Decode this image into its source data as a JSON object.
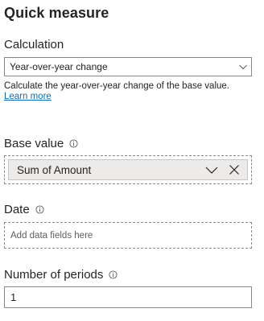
{
  "panel": {
    "title": "Quick measure"
  },
  "calculation": {
    "label": "Calculation",
    "selected": "Year-over-year change",
    "description": "Calculate the year-over-year change of the base value.",
    "learn_more": "Learn more"
  },
  "base_value": {
    "label": "Base value",
    "field": "Sum of Amount"
  },
  "date": {
    "label": "Date",
    "placeholder": "Add data fields here"
  },
  "periods": {
    "label": "Number of periods",
    "value": "1"
  },
  "colors": {
    "link": "#0f6cbd",
    "chip_bg": "#edebe9",
    "border": "#8a8886",
    "text": "#252423"
  },
  "icons": {
    "info": "info-icon",
    "dropdown": "chevron-down-icon",
    "remove": "close-icon"
  }
}
